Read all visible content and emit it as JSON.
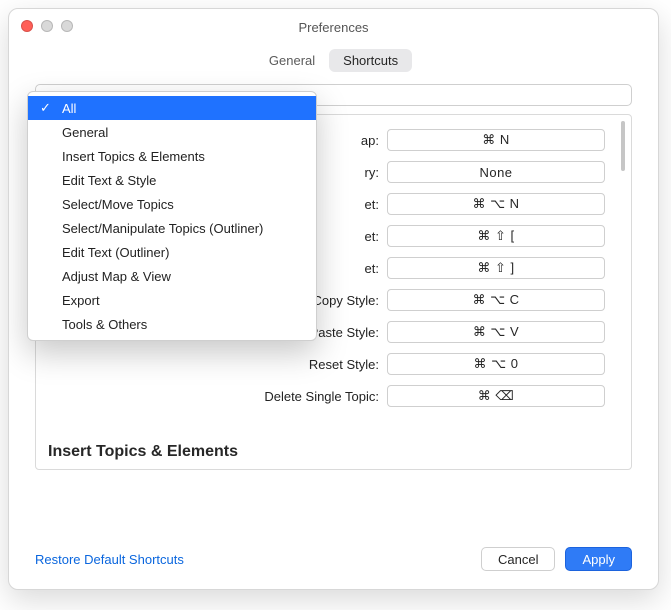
{
  "window": {
    "title": "Preferences"
  },
  "tabs": {
    "general": "General",
    "shortcuts": "Shortcuts"
  },
  "shortcuts": {
    "rows": [
      {
        "label": "ap:",
        "value": "⌘ N"
      },
      {
        "label": "ry:",
        "value": "None"
      },
      {
        "label": "et:",
        "value": "⌘ ⌥ N"
      },
      {
        "label": "et:",
        "value": "⌘ ⇧ ["
      },
      {
        "label": "et:",
        "value": "⌘ ⇧ ]"
      },
      {
        "label": "Copy Style:",
        "value": "⌘ ⌥ C"
      },
      {
        "label": "Paste Style:",
        "value": "⌘ ⌥ V"
      },
      {
        "label": "Reset Style:",
        "value": "⌘ ⌥ 0"
      },
      {
        "label": "Delete Single Topic:",
        "value": "⌘ ⌫"
      }
    ],
    "section_title": "Insert Topics & Elements"
  },
  "dropdown": {
    "items": [
      "All",
      "General",
      "Insert Topics & Elements",
      "Edit Text & Style",
      "Select/Move Topics",
      "Select/Manipulate Topics (Outliner)",
      "Edit Text (Outliner)",
      "Adjust Map & View",
      "Export",
      "Tools & Others"
    ]
  },
  "footer": {
    "restore": "Restore Default Shortcuts",
    "cancel": "Cancel",
    "apply": "Apply"
  }
}
